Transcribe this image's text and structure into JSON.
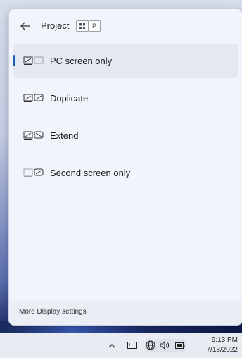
{
  "flyout": {
    "title": "Project",
    "shortcut_keys": [
      "⊞",
      "P"
    ],
    "options": [
      {
        "label": "PC screen only",
        "icon": "pc-screen-only-icon",
        "selected": true
      },
      {
        "label": "Duplicate",
        "icon": "duplicate-icon",
        "selected": false
      },
      {
        "label": "Extend",
        "icon": "extend-icon",
        "selected": false
      },
      {
        "label": "Second screen only",
        "icon": "second-screen-only-icon",
        "selected": false
      }
    ],
    "footer_link": "More Display settings"
  },
  "taskbar": {
    "tray_icons": [
      "chevron-up-icon",
      "keyboard-icon",
      "network-icon",
      "volume-icon",
      "battery-icon"
    ],
    "time": "9:13 PM",
    "date": "7/18/2022"
  },
  "colors": {
    "accent": "#0f63c7",
    "flyout_bg": "#f2f4fb"
  }
}
